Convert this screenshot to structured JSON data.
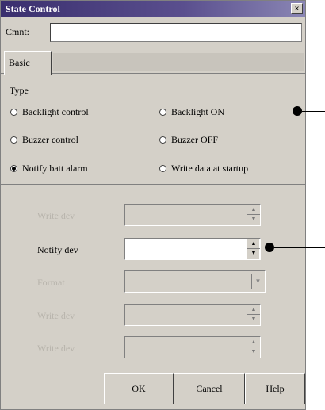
{
  "dialog": {
    "title": "State Control",
    "close_label": "×"
  },
  "comment": {
    "label": "Cmnt:",
    "value": ""
  },
  "tabs": {
    "active": "Basic"
  },
  "type_group": {
    "title": "Type",
    "options": [
      {
        "label": "Backlight control",
        "selected": false
      },
      {
        "label": "Backlight ON",
        "selected": false
      },
      {
        "label": "Buzzer control",
        "selected": false
      },
      {
        "label": "Buzzer OFF",
        "selected": false
      },
      {
        "label": "Notify batt alarm",
        "selected": true
      },
      {
        "label": "Write data at startup",
        "selected": false
      }
    ]
  },
  "settings": {
    "rows": [
      {
        "label": "Write dev",
        "enabled": false
      },
      {
        "label": "Notify dev",
        "enabled": true
      },
      {
        "label": "Format",
        "enabled": false
      },
      {
        "label": "Write dev",
        "enabled": false
      },
      {
        "label": "Write dev",
        "enabled": false
      }
    ]
  },
  "buttons": {
    "ok": "OK",
    "cancel": "Cancel",
    "help": "Help"
  },
  "colors": {
    "titlebar": "#3a2f6e",
    "face": "#d4d0c8"
  }
}
